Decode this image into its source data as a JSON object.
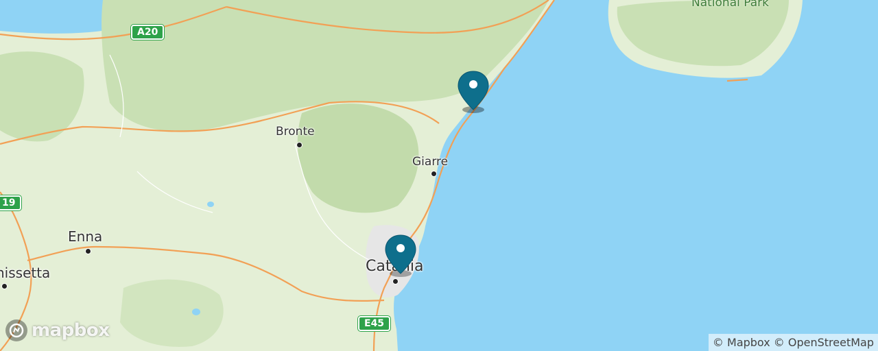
{
  "map": {
    "places": [
      {
        "name": "Bronte"
      },
      {
        "name": "Giarre"
      },
      {
        "name": "Enna"
      },
      {
        "name": "Catania"
      },
      {
        "name": "nissetta"
      }
    ],
    "parks": [
      {
        "name": "National Park"
      }
    ],
    "road_shields": [
      {
        "label": "A20"
      },
      {
        "label": "19"
      },
      {
        "label": "E45"
      }
    ],
    "markers": [
      {
        "id": "marker-north",
        "color": "#0e6f8c"
      },
      {
        "id": "marker-catania",
        "color": "#0e6f8c"
      }
    ],
    "colors": {
      "sea": "#8fd3f5",
      "land": "#e4efd6",
      "forest": "#c9e0b4",
      "road": "#f2a055",
      "marker": "#0e6f8c",
      "shield": "#2ea24a"
    }
  },
  "logo": {
    "text": "mapbox"
  },
  "attribution": {
    "mapbox": "© Mapbox",
    "osm": "© OpenStreetMap"
  }
}
